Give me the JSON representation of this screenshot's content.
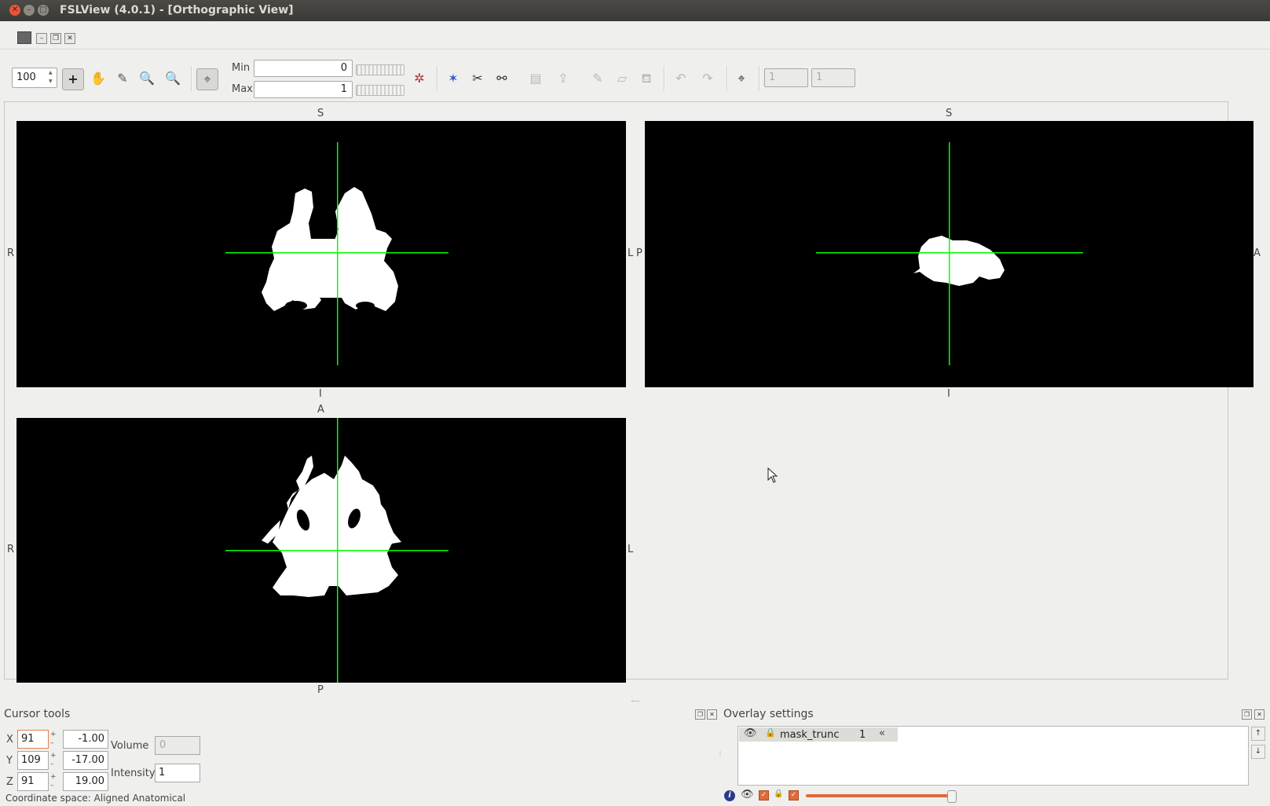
{
  "window": {
    "title": "FSLView (4.0.1) - [Orthographic View]"
  },
  "toolbar": {
    "zoom_value": "100",
    "min_label": "Min",
    "min_value": "0",
    "max_label": "Max",
    "max_value": "1",
    "spin1_value": "1",
    "spin2_value": "1"
  },
  "views": {
    "coronal": {
      "top": "S",
      "bottom": "I",
      "left": "R",
      "right": "L"
    },
    "sagittal": {
      "top": "S",
      "bottom": "I",
      "left": "P",
      "right": "A"
    },
    "axial": {
      "top": "A",
      "bottom": "P",
      "left": "R",
      "right": "L"
    }
  },
  "cursor_tools": {
    "title": "Cursor tools",
    "x_label": "X",
    "x_voxel": "91",
    "x_mm": "-1.00",
    "y_label": "Y",
    "y_voxel": "109",
    "y_mm": "-17.00",
    "z_label": "Z",
    "z_voxel": "91",
    "z_mm": "19.00",
    "volume_label": "Volume",
    "volume_value": "0",
    "intensity_label": "Intensity",
    "intensity_value": "1",
    "coordinate_space": "Coordinate space: Aligned Anatomical"
  },
  "overlay_settings": {
    "title": "Overlay settings",
    "layers": [
      {
        "name": "mask_trunc",
        "index": "1"
      }
    ],
    "opacity": 0.98
  },
  "colors": {
    "crosshair": "#00ff00",
    "mask": "#ffffff",
    "background": "#000000"
  }
}
